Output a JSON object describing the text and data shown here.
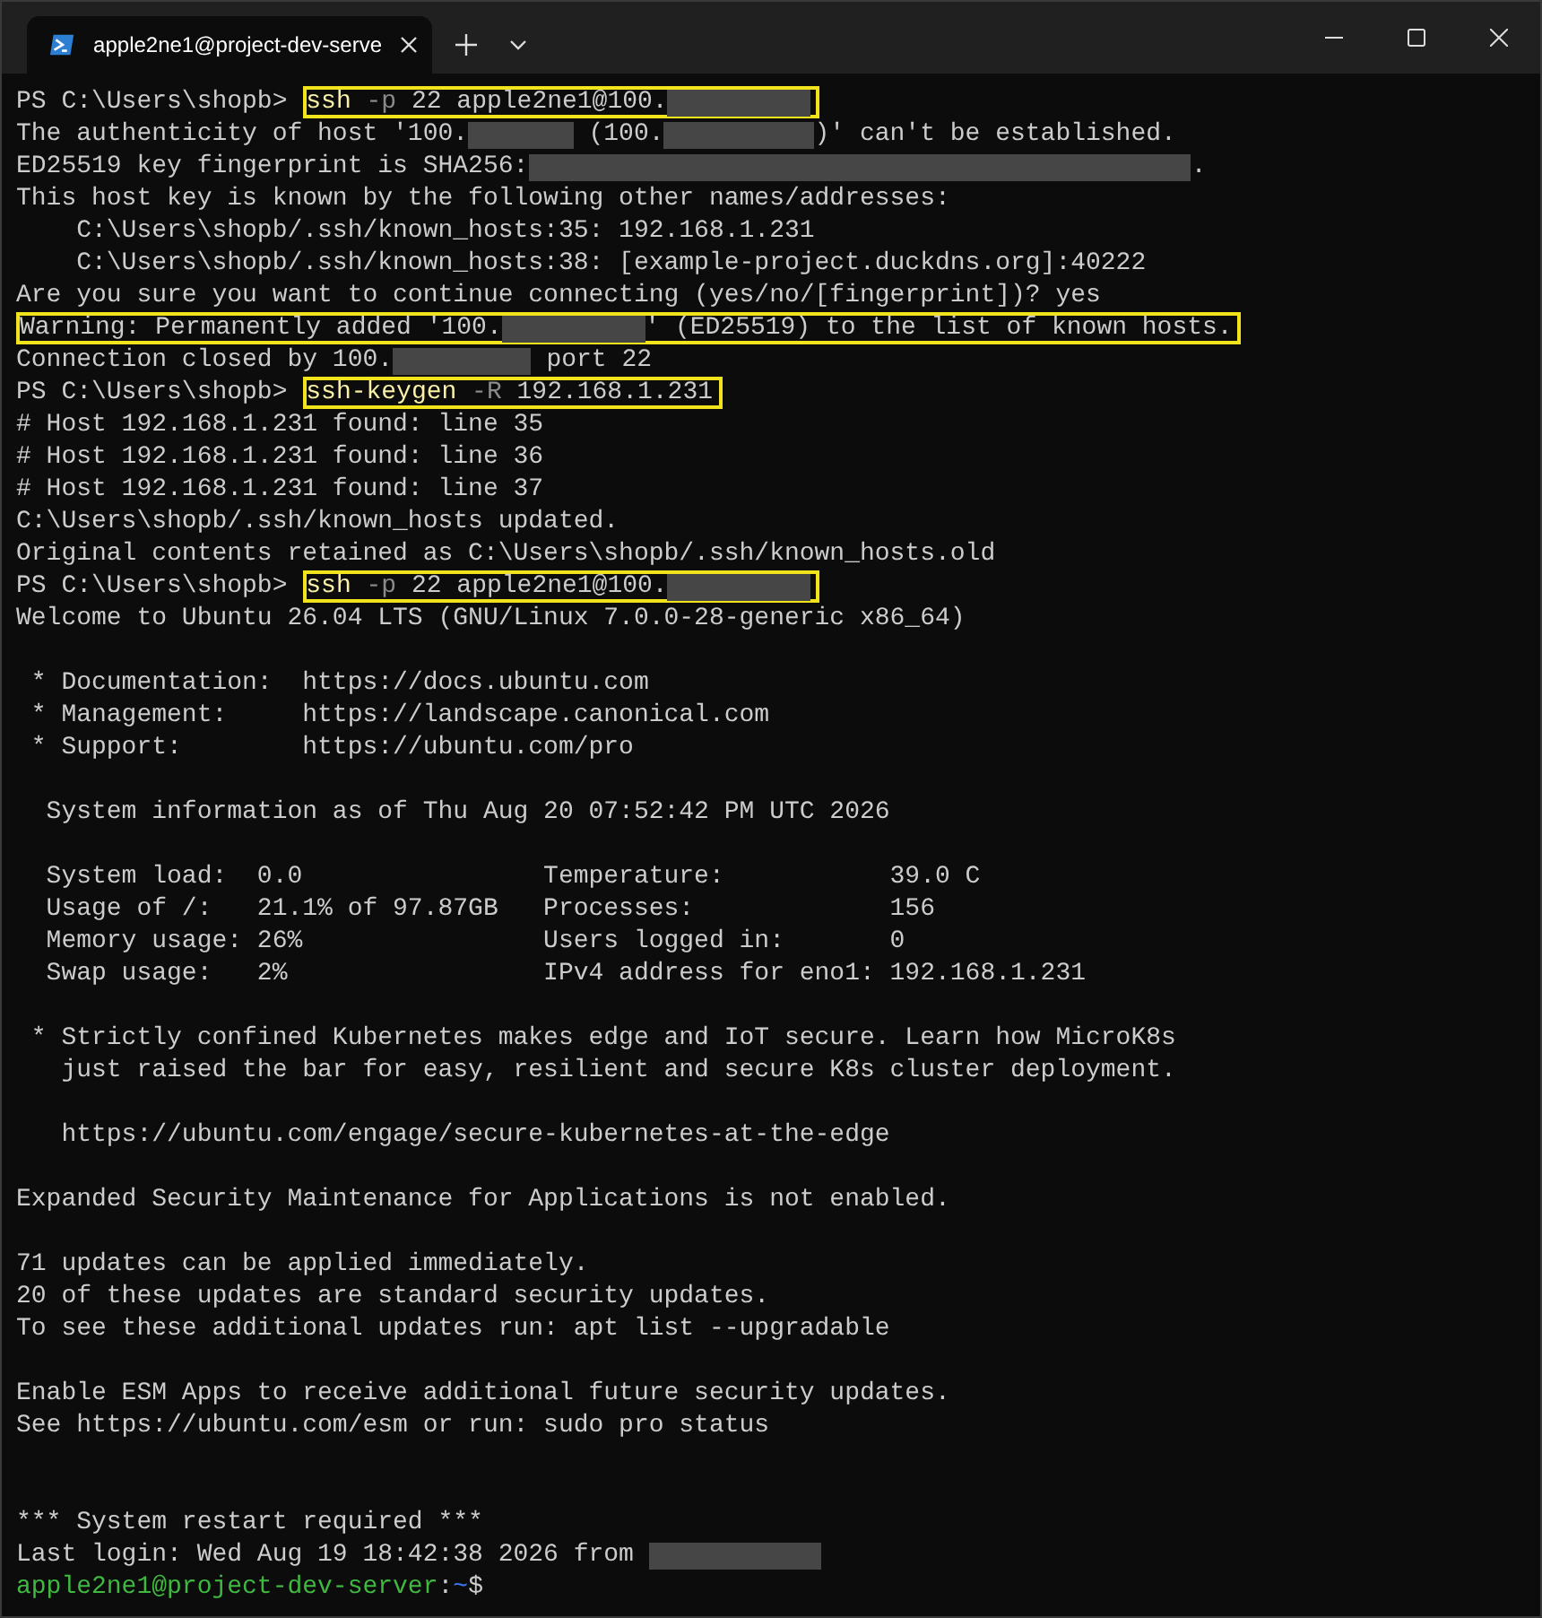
{
  "window": {
    "tabs": [
      {
        "title": "apple2ne1@project-dev-serve",
        "selected": true
      }
    ]
  },
  "terminal": {
    "lines": [
      {
        "kind": "content",
        "segments": [
          {
            "kind": "prompt",
            "text": "PS C:\\Users\\shopb> "
          },
          {
            "kind": "box",
            "parts": [
              {
                "kind": "command",
                "text": "ssh"
              },
              {
                "kind": "param",
                "text": " -p"
              },
              {
                "kind": "text",
                "text": " 22 apple2ne1@100."
              },
              {
                "kind": "redacted"
              }
            ]
          }
        ]
      },
      {
        "kind": "content",
        "segments": [
          {
            "kind": "text",
            "text": "The authenticity of host '100."
          },
          {
            "kind": "redacted"
          },
          {
            "kind": "text",
            "text": " (100."
          },
          {
            "kind": "redacted"
          },
          {
            "kind": "text",
            "text": ")' can't be established."
          }
        ]
      },
      {
        "kind": "content",
        "segments": [
          {
            "kind": "text",
            "text": "ED25519 key fingerprint is SHA256:"
          },
          {
            "kind": "redacted"
          },
          {
            "kind": "text",
            "text": "."
          }
        ]
      },
      {
        "kind": "content",
        "segments": [
          {
            "kind": "text",
            "text": "This host key is known by the following other names/addresses:"
          }
        ]
      },
      {
        "kind": "content",
        "segments": [
          {
            "kind": "text",
            "text": "    C:\\Users\\shopb/.ssh/known_hosts:35: 192.168.1.231"
          }
        ]
      },
      {
        "kind": "content",
        "segments": [
          {
            "kind": "text",
            "text": "    C:\\Users\\shopb/.ssh/known_hosts:38: [example-project.duckdns.org]:40222"
          }
        ]
      },
      {
        "kind": "content",
        "segments": [
          {
            "kind": "text",
            "text": "Are you sure you want to continue connecting (yes/no/[fingerprint])? yes"
          }
        ]
      },
      {
        "kind": "content",
        "segments": [
          {
            "kind": "box",
            "parts": [
              {
                "kind": "text",
                "text": "Warning: Permanently added '100."
              },
              {
                "kind": "redacted"
              },
              {
                "kind": "text",
                "text": "' (ED25519) to the list of known hosts."
              }
            ]
          }
        ]
      },
      {
        "kind": "content",
        "segments": [
          {
            "kind": "text",
            "text": "Connection closed by 100."
          },
          {
            "kind": "redacted"
          },
          {
            "kind": "text",
            "text": " port 22"
          }
        ]
      },
      {
        "kind": "content",
        "segments": [
          {
            "kind": "prompt",
            "text": "PS C:\\Users\\shopb> "
          },
          {
            "kind": "box",
            "parts": [
              {
                "kind": "command",
                "text": "ssh-keygen"
              },
              {
                "kind": "param",
                "text": " -R"
              },
              {
                "kind": "text",
                "text": " 192.168.1.231"
              }
            ]
          }
        ]
      },
      {
        "kind": "content",
        "segments": [
          {
            "kind": "text",
            "text": "# Host 192.168.1.231 found: line 35"
          }
        ]
      },
      {
        "kind": "content",
        "segments": [
          {
            "kind": "text",
            "text": "# Host 192.168.1.231 found: line 36"
          }
        ]
      },
      {
        "kind": "content",
        "segments": [
          {
            "kind": "text",
            "text": "# Host 192.168.1.231 found: line 37"
          }
        ]
      },
      {
        "kind": "content",
        "segments": [
          {
            "kind": "text",
            "text": "C:\\Users\\shopb/.ssh/known_hosts updated."
          }
        ]
      },
      {
        "kind": "content",
        "segments": [
          {
            "kind": "text",
            "text": "Original contents retained as C:\\Users\\shopb/.ssh/known_hosts.old"
          }
        ]
      },
      {
        "kind": "content",
        "segments": [
          {
            "kind": "prompt",
            "text": "PS C:\\Users\\shopb> "
          },
          {
            "kind": "box",
            "parts": [
              {
                "kind": "command",
                "text": "ssh"
              },
              {
                "kind": "param",
                "text": " -p"
              },
              {
                "kind": "text",
                "text": " 22 apple2ne1@100."
              },
              {
                "kind": "redacted"
              }
            ]
          }
        ]
      },
      {
        "kind": "content",
        "segments": [
          {
            "kind": "text",
            "text": "Welcome to Ubuntu 26.04 LTS (GNU/Linux 7.0.0-28-generic x86_64)"
          }
        ]
      },
      {
        "kind": "blank"
      },
      {
        "kind": "content",
        "segments": [
          {
            "kind": "text",
            "text": " * Documentation:  https://docs.ubuntu.com"
          }
        ]
      },
      {
        "kind": "content",
        "segments": [
          {
            "kind": "text",
            "text": " * Management:     https://landscape.canonical.com"
          }
        ]
      },
      {
        "kind": "content",
        "segments": [
          {
            "kind": "text",
            "text": " * Support:        https://ubuntu.com/pro"
          }
        ]
      },
      {
        "kind": "blank"
      },
      {
        "kind": "content",
        "segments": [
          {
            "kind": "text",
            "text": "  System information as of Thu Aug 20 07:52:42 PM UTC 2026"
          }
        ]
      },
      {
        "kind": "blank"
      },
      {
        "kind": "content",
        "segments": [
          {
            "kind": "text",
            "text": "  System load:  0.0                Temperature:           39.0 C"
          }
        ]
      },
      {
        "kind": "content",
        "segments": [
          {
            "kind": "text",
            "text": "  Usage of /:   21.1% of 97.87GB   Processes:             156"
          }
        ]
      },
      {
        "kind": "content",
        "segments": [
          {
            "kind": "text",
            "text": "  Memory usage: 26%                Users logged in:       0"
          }
        ]
      },
      {
        "kind": "content",
        "segments": [
          {
            "kind": "text",
            "text": "  Swap usage:   2%                 IPv4 address for eno1: 192.168.1.231"
          }
        ]
      },
      {
        "kind": "blank"
      },
      {
        "kind": "content",
        "segments": [
          {
            "kind": "text",
            "text": " * Strictly confined Kubernetes makes edge and IoT secure. Learn how MicroK8s"
          }
        ]
      },
      {
        "kind": "content",
        "segments": [
          {
            "kind": "text",
            "text": "   just raised the bar for easy, resilient and secure K8s cluster deployment."
          }
        ]
      },
      {
        "kind": "blank"
      },
      {
        "kind": "content",
        "segments": [
          {
            "kind": "text",
            "text": "   https://ubuntu.com/engage/secure-kubernetes-at-the-edge"
          }
        ]
      },
      {
        "kind": "blank"
      },
      {
        "kind": "content",
        "segments": [
          {
            "kind": "text",
            "text": "Expanded Security Maintenance for Applications is not enabled."
          }
        ]
      },
      {
        "kind": "blank"
      },
      {
        "kind": "content",
        "segments": [
          {
            "kind": "text",
            "text": "71 updates can be applied immediately."
          }
        ]
      },
      {
        "kind": "content",
        "segments": [
          {
            "kind": "text",
            "text": "20 of these updates are standard security updates."
          }
        ]
      },
      {
        "kind": "content",
        "segments": [
          {
            "kind": "text",
            "text": "To see these additional updates run: apt list --upgradable"
          }
        ]
      },
      {
        "kind": "blank"
      },
      {
        "kind": "content",
        "segments": [
          {
            "kind": "text",
            "text": "Enable ESM Apps to receive additional future security updates."
          }
        ]
      },
      {
        "kind": "content",
        "segments": [
          {
            "kind": "text",
            "text": "See https://ubuntu.com/esm or run: sudo pro status"
          }
        ]
      },
      {
        "kind": "blank"
      },
      {
        "kind": "blank"
      },
      {
        "kind": "content",
        "segments": [
          {
            "kind": "text",
            "text": "*** System restart required ***"
          }
        ]
      },
      {
        "kind": "content",
        "segments": [
          {
            "kind": "text",
            "text": "Last login: Wed Aug 19 18:42:38 2026 from "
          },
          {
            "kind": "redacted"
          }
        ]
      },
      {
        "kind": "content",
        "segments": [
          {
            "kind": "user",
            "text": "apple2ne1@project-dev-server"
          },
          {
            "kind": "text",
            "text": ":"
          },
          {
            "kind": "dir",
            "text": "~"
          },
          {
            "kind": "text",
            "text": "$"
          }
        ]
      }
    ]
  }
}
